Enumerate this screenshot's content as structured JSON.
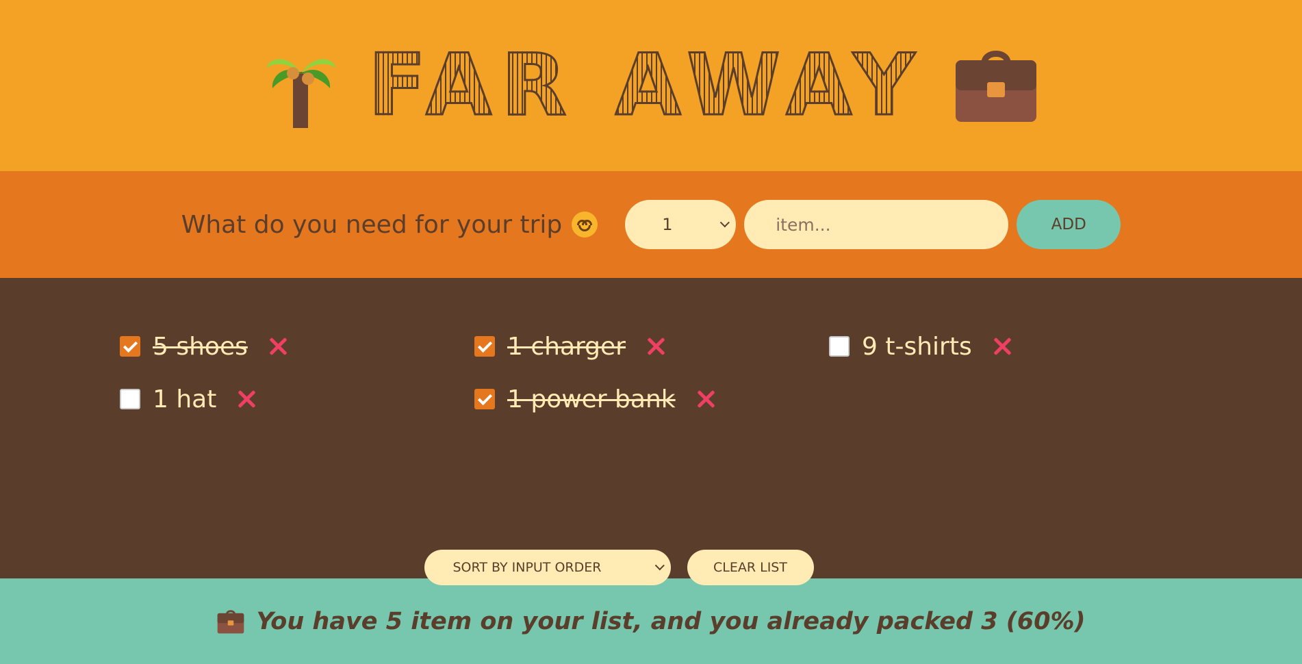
{
  "header": {
    "title": "FAR AWAY",
    "left_icon": "palm-tree-icon",
    "right_icon": "briefcase-icon"
  },
  "form": {
    "question": "What do you need for your trip",
    "question_emoji": "smiling-face-icon",
    "quantity_value": "1",
    "item_placeholder": "item...",
    "add_label": "ADD"
  },
  "items": [
    {
      "text": "5 shoes",
      "packed": true
    },
    {
      "text": "1 charger",
      "packed": true
    },
    {
      "text": "9 t-shirts",
      "packed": false
    },
    {
      "text": "1 hat",
      "packed": false
    },
    {
      "text": "1 power bank",
      "packed": true
    }
  ],
  "actions": {
    "sort_value": "SORT BY INPUT ORDER",
    "clear_label": "CLEAR LIST"
  },
  "stats": {
    "icon": "briefcase-icon",
    "text": "You have 5 item on your list, and you already packed 3 (60%)"
  },
  "colors": {
    "header_bg": "#f4a226",
    "form_bg": "#e5771e",
    "list_bg": "#5a3e2b",
    "footer_bg": "#76c7ad",
    "cream": "#ffebb3",
    "delete": "#ef3f63"
  }
}
